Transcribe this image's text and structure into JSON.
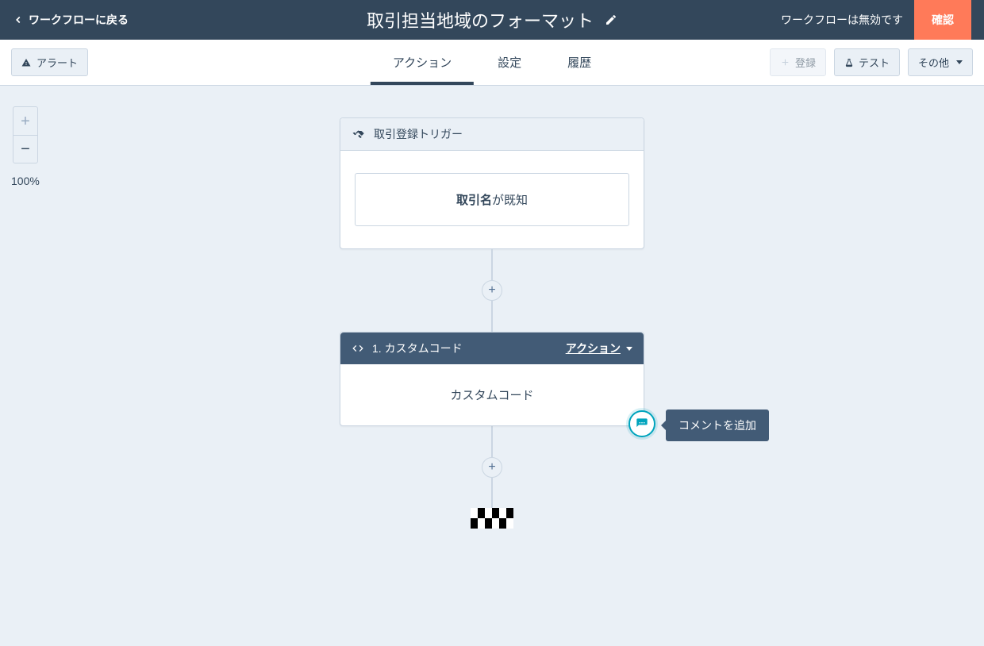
{
  "header": {
    "back_label": "ワークフローに戻る",
    "title": "取引担当地域のフォーマット",
    "disabled_status": "ワークフローは無効です",
    "confirm_label": "確認"
  },
  "toolbar": {
    "alert_label": "アラート",
    "tabs": {
      "action": "アクション",
      "settings": "設定",
      "history": "履歴"
    },
    "enroll_label": "登録",
    "test_label": "テスト",
    "more_label": "その他"
  },
  "zoom": {
    "level": "100%"
  },
  "trigger": {
    "header_label": "取引登録トリガー",
    "condition_bold": "取引名",
    "condition_rest": "が既知"
  },
  "action_card": {
    "index_label": "1. カスタムコード",
    "dropdown_label": "アクション",
    "body_label": "カスタムコード"
  },
  "comment": {
    "tooltip": "コメントを追加"
  }
}
